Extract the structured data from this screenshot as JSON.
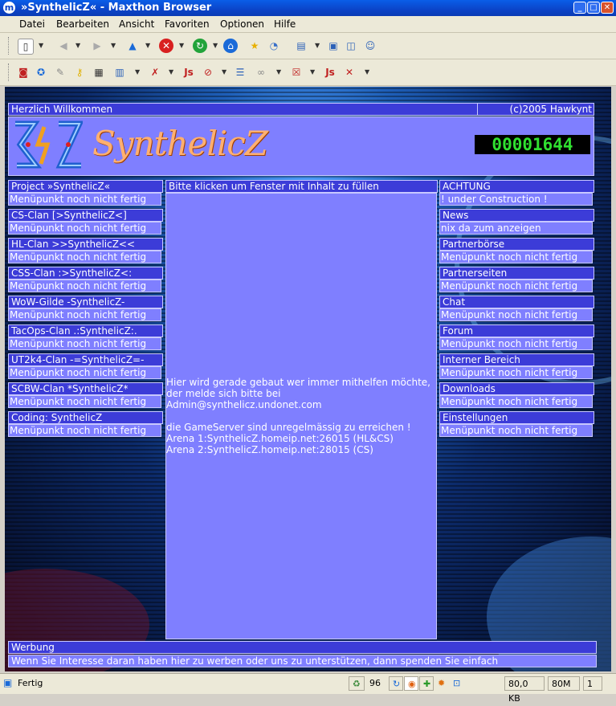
{
  "window": {
    "title": "»SynthelicZ« - Maxthon Browser"
  },
  "menu": [
    "Datei",
    "Bearbeiten",
    "Ansicht",
    "Favoriten",
    "Optionen",
    "Hilfe"
  ],
  "site": {
    "welcome": "Herzlich Willkommen",
    "copyright": "(c)2005 Hawkynt",
    "logo_text": "SynthelicZ",
    "counter": "00001644",
    "center_header": "Bitte klicken um Fenster mit Inhalt zu füllen",
    "center_lines": [
      "Hier wird gerade gebaut wer immer mithelfen möchte,",
      "der melde sich bitte bei",
      "Admin@synthelicz.undonet.com",
      "",
      "die GameServer sind unregelmässig zu erreichen !",
      "Arena 1:SynthelicZ.homeip.net:26015 (HL&CS)",
      "Arena 2:SynthelicZ.homeip.net:28015 (CS)"
    ],
    "left_menu": [
      {
        "title": "Project »SynthelicZ«",
        "sub": "Menüpunkt noch nicht fertig"
      },
      {
        "title": "CS-Clan [>SynthelicZ<]",
        "sub": "Menüpunkt noch nicht fertig"
      },
      {
        "title": "HL-Clan >>SynthelicZ<<",
        "sub": "Menüpunkt noch nicht fertig"
      },
      {
        "title": "CSS-Clan :>SynthelicZ<:",
        "sub": "Menüpunkt noch nicht fertig"
      },
      {
        "title": "WoW-Gilde -SynthelicZ-",
        "sub": "Menüpunkt noch nicht fertig"
      },
      {
        "title": "TacOps-Clan .:SynthelicZ:.",
        "sub": "Menüpunkt noch nicht fertig"
      },
      {
        "title": "UT2k4-Clan -=SynthelicZ=-",
        "sub": "Menüpunkt noch nicht fertig"
      },
      {
        "title": "SCBW-Clan *SynthelicZ*",
        "sub": "Menüpunkt noch nicht fertig"
      },
      {
        "title": "Coding: SynthelicZ",
        "sub": "Menüpunkt noch nicht fertig"
      }
    ],
    "right_menu": [
      {
        "title": "ACHTUNG",
        "sub": "! under Construction !"
      },
      {
        "title": "News",
        "sub": "nix da zum anzeigen"
      },
      {
        "title": "Partnerbörse",
        "sub": "Menüpunkt noch nicht fertig"
      },
      {
        "title": "Partnerseiten",
        "sub": "Menüpunkt noch nicht fertig"
      },
      {
        "title": "Chat",
        "sub": "Menüpunkt noch nicht fertig"
      },
      {
        "title": "Forum",
        "sub": "Menüpunkt noch nicht fertig"
      },
      {
        "title": "Interner Bereich",
        "sub": "Menüpunkt noch nicht fertig"
      },
      {
        "title": "Downloads",
        "sub": "Menüpunkt noch nicht fertig"
      },
      {
        "title": "Einstellungen",
        "sub": "Menüpunkt noch nicht fertig"
      }
    ],
    "ad_header": "Werbung",
    "ad_text": "Wenn Sie Interesse daran haben hier zu werben oder uns zu unterstützen, dann spenden Sie einfach"
  },
  "status": {
    "text": "Fertig",
    "count": "96",
    "size": "80,0 KB",
    "mem": "80M",
    "tabs": "1"
  }
}
